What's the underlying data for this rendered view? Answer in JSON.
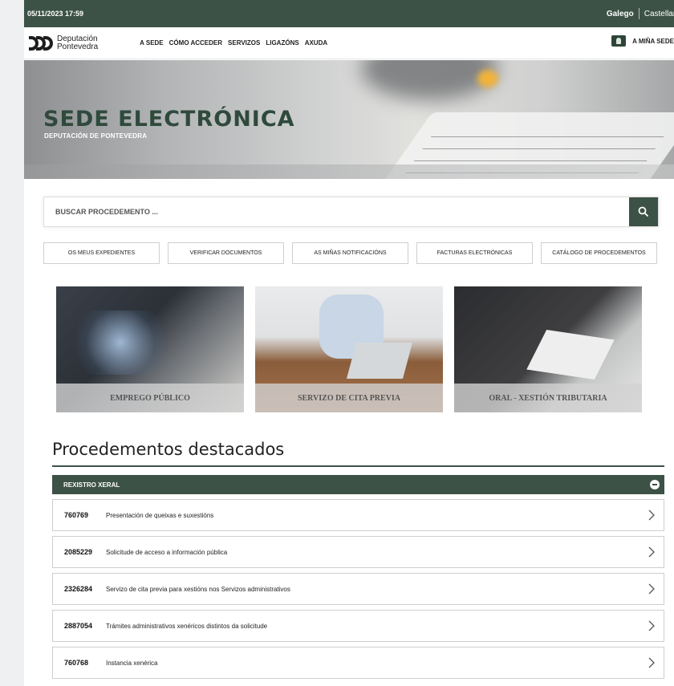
{
  "topbar": {
    "datetime": "05/11/2023 17:59",
    "languages": [
      "Galego",
      "Castellano"
    ]
  },
  "header": {
    "logo_line1": "Deputación",
    "logo_line2": "Pontevedra",
    "nav": [
      "A SEDE",
      "CÓMO ACCEDER",
      "SERVIZOS",
      "LIGAZÓNS",
      "AXUDA"
    ],
    "my_sede": "A MIÑA SEDE"
  },
  "hero": {
    "title": "SEDE ELECTRÓNICA",
    "subtitle": "DEPUTACIÓN DE PONTEVEDRA"
  },
  "search": {
    "placeholder": "BUSCAR PROCEDEMENTO ..."
  },
  "quick_links": [
    "OS MEUS EXPEDIENTES",
    "VERIFICAR DOCUMENTOS",
    "AS MIÑAS NOTIFICACIÓNS",
    "FACTURAS ELECTRÓNICAS",
    "CATÁLOGO DE PROCEDEMENTOS"
  ],
  "cards": [
    "EMPREGO PÚBLICO",
    "SERVIZO DE CITA PREVIA",
    "ORAL - XESTIÓN TRIBUTARIA"
  ],
  "featured": {
    "title": "Procedementos destacados",
    "group": "REXISTRO XERAL",
    "items": [
      {
        "code": "760769",
        "label": "Presentación de queixas e suxestións"
      },
      {
        "code": "2085229",
        "label": "Solicitude de acceso a información pública"
      },
      {
        "code": "2326284",
        "label": "Servizo de cita previa para xestións nos Servizos administrativos"
      },
      {
        "code": "2887054",
        "label": "Trámites administrativos xenéricos distintos da solicitude"
      },
      {
        "code": "760768",
        "label": "Instancia xenérica"
      }
    ]
  },
  "colors": {
    "brand_green": "#3c5246"
  }
}
